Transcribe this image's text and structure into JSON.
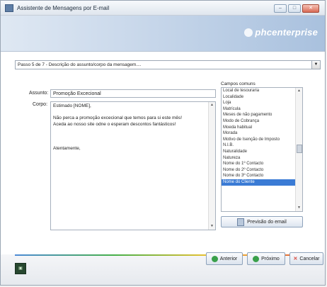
{
  "window": {
    "title": "Assistente de Mensagens por E-mail",
    "brand": "phcenterprise"
  },
  "step": {
    "value": "Passo 5 de 7 - Descrição do assunto/corpo da mensagem...."
  },
  "form": {
    "assunto_label": "Assunto:",
    "assunto_value": "Promoção Excecional",
    "corpo_label": "Corpo:",
    "corpo_lines": [
      "Estimado [NOME],",
      "",
      "Não perca a promoção excecional que temos para si este mês!",
      "Aceda ao nosso site odne o esperam descontos fantásticos!",
      "",
      "",
      "",
      "Atentamente,"
    ]
  },
  "campos": {
    "title": "Campos comuns",
    "items": [
      "Local de tesouraria",
      "Localidade",
      "Loja",
      "Matrícula",
      "Meses de não pagamento",
      "Modo de Cobrança",
      "Moeda habitual",
      "Morada",
      "Motivo de Isenção de Imposto",
      "N.I.B.",
      "Naturalidade",
      "Natureza",
      "Nome do 1º Contacto",
      "Nome do 2º Contacto",
      "Nome do 3º Contacto",
      "Nome do Cliente"
    ],
    "selected_index": 15,
    "preview_label": "Previsão do email"
  },
  "buttons": {
    "anterior": "Anterior",
    "proximo": "Próximo",
    "cancelar": "Cancelar"
  },
  "colors": {
    "accent": "#3a7bd5",
    "cancel": "#d9463a",
    "nav": "#3aa04a"
  }
}
